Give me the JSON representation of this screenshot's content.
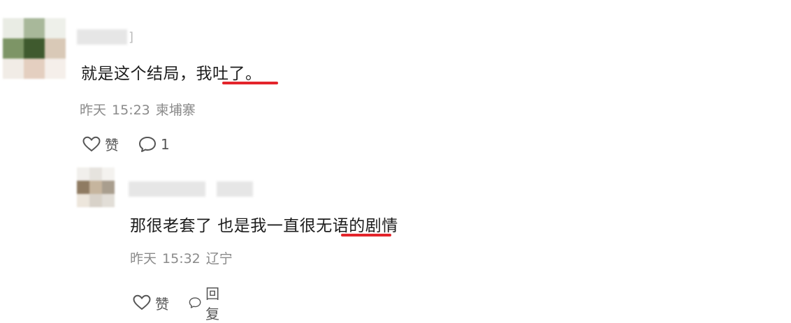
{
  "comments": [
    {
      "text": "就是这个结局，我吐了。",
      "date": "昨天",
      "time": "15:23",
      "location": "柬埔寨",
      "like_label": "赞",
      "reply_count": "1"
    },
    {
      "text": "那很老套了 也是我一直很无语的剧情",
      "date": "昨天",
      "time": "15:32",
      "location": "辽宁",
      "like_label": "赞",
      "reply_label": "回复"
    }
  ],
  "colors": {
    "underline": "#e3242b",
    "meta_text": "#8a8a8a",
    "body_text": "#1c1c1c"
  },
  "icons": [
    "heart-icon",
    "comment-bubble-icon"
  ]
}
